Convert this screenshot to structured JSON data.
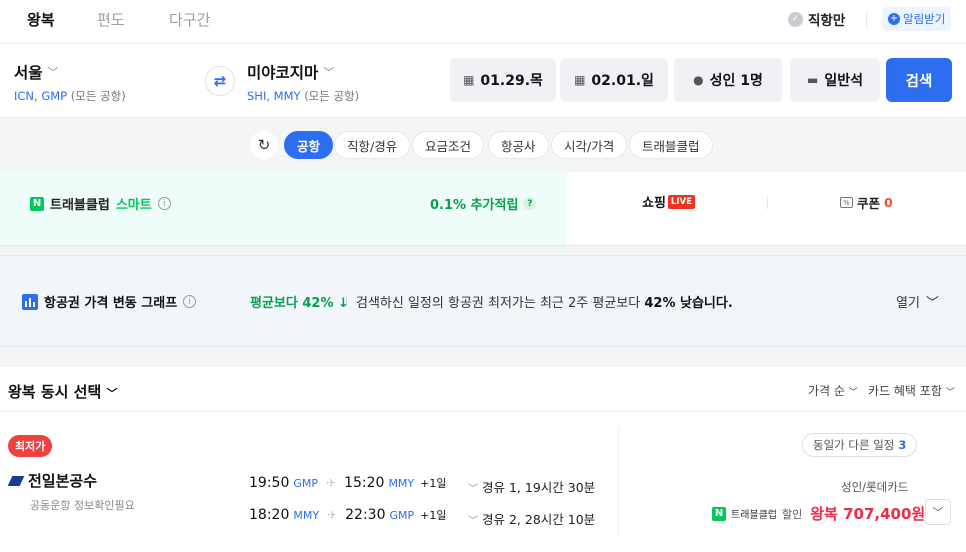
{
  "trip_tabs": [
    "왕복",
    "편도",
    "다구간"
  ],
  "direct_only_label": "직항만",
  "alert_label": "알림받기",
  "origin": {
    "city": "서울",
    "codes": "ICN, GMP",
    "note": "(모든 공항)"
  },
  "destination": {
    "city": "미야코지마",
    "codes": "SHI, MMY",
    "note": "(모든 공항)"
  },
  "depart_date": "01.29.목",
  "return_date": "02.01.일",
  "passengers": "성인 1명",
  "cabin": "일반석",
  "search_label": "검색",
  "filter_chips": [
    "공항",
    "직항/경유",
    "요금조건",
    "항공사",
    "시각/가격",
    "트래블클럽"
  ],
  "club": {
    "name": "트래블클럽",
    "smart": "스마트",
    "accrual": "0.1% 추가적립",
    "shopping": "쇼핑",
    "live": "LIVE",
    "coupon_label": "쿠폰",
    "coupon_count": "0"
  },
  "price_graph": {
    "title": "항공권 가격 변동 그래프",
    "avg_badge": "평균보다 42% ↓",
    "desc_prefix": "검색하신 일정의 항공권 최저가는 최근 2주 평균보다 ",
    "desc_bold": "42% 낮습니다.",
    "open_label": "열기"
  },
  "results": {
    "title": "왕복 동시 선택",
    "sort_label": "가격 순",
    "card_label": "카드 혜택 포함",
    "item": {
      "badge": "최저가",
      "airline": "전일본공수",
      "codeshare": "공동운항 정보확인필요",
      "legs": [
        {
          "dep_time": "19:50",
          "dep_ap": "GMP",
          "arr_time": "15:20",
          "arr_ap": "MMY",
          "plus_day": "+1일",
          "stops": "경유 1, 19시간 30분"
        },
        {
          "dep_time": "18:20",
          "dep_ap": "MMY",
          "arr_time": "22:30",
          "arr_ap": "GMP",
          "plus_day": "+1일",
          "stops": "경유 2, 28시간 10분"
        }
      ],
      "other_schedules_label": "동일가 다른 일정",
      "other_schedules_count": "3",
      "card_name": "성인/롯데카드",
      "club_label": "트래블클럽",
      "discount_label": "할인",
      "price": "왕복 707,400원~"
    }
  }
}
